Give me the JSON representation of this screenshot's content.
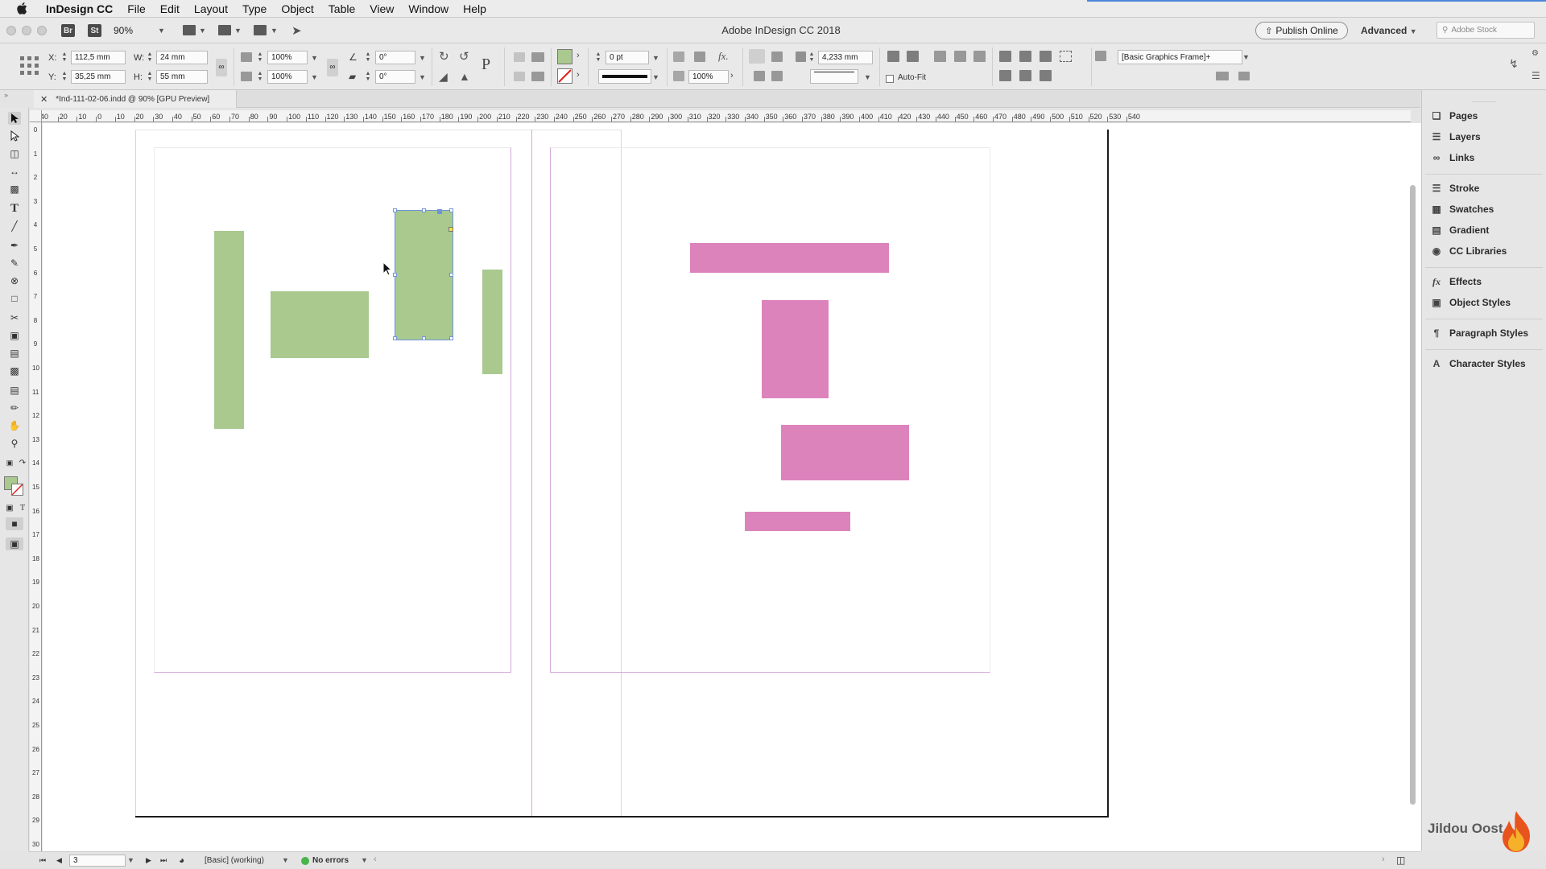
{
  "menubar": {
    "app_name": "InDesign CC",
    "items": [
      "File",
      "Edit",
      "Layout",
      "Type",
      "Object",
      "Table",
      "View",
      "Window",
      "Help"
    ]
  },
  "appbar": {
    "bridge_label": "Br",
    "stock_label": "St",
    "zoom": "90%",
    "title": "Adobe InDesign CC 2018",
    "publish_label": "Publish Online",
    "workspace_label": "Advanced",
    "search_placeholder": "Adobe Stock"
  },
  "control": {
    "x_label": "X:",
    "x_value": "112,5 mm",
    "y_label": "Y:",
    "y_value": "35,25 mm",
    "w_label": "W:",
    "w_value": "24 mm",
    "h_label": "H:",
    "h_value": "55 mm",
    "scale_x": "100%",
    "scale_y": "100%",
    "rotate": "0°",
    "shear": "0°",
    "stroke_weight": "0 pt",
    "opacity": "100%",
    "corner": "4,233 mm",
    "autofit_label": "Auto-Fit",
    "object_style": "[Basic Graphics Frame]+",
    "fill_color": "#a9c98f"
  },
  "document": {
    "tab_label": "*Ind-111-02-06.indd @ 90% [GPU Preview]"
  },
  "ruler": {
    "h_labels": [
      "40",
      "20",
      "10",
      "0",
      "10",
      "20",
      "30",
      "40",
      "50",
      "60",
      "70",
      "80",
      "90",
      "100",
      "110",
      "120",
      "130",
      "140",
      "150",
      "160",
      "170",
      "180",
      "190",
      "200",
      "210",
      "220",
      "230",
      "240",
      "250",
      "260",
      "270",
      "280",
      "290",
      "300",
      "310",
      "320",
      "330",
      "340",
      "350",
      "360",
      "370",
      "380",
      "390",
      "400",
      "410",
      "420",
      "430",
      "440",
      "450",
      "460",
      "470",
      "480",
      "490",
      "500",
      "510",
      "520",
      "530",
      "540"
    ],
    "v_labels": [
      "0",
      "1",
      "2",
      "3",
      "4",
      "5",
      "6",
      "7",
      "8",
      "9",
      "10",
      "11",
      "12",
      "13",
      "14",
      "15",
      "16",
      "17",
      "18",
      "19",
      "20",
      "21",
      "22",
      "23",
      "24",
      "25",
      "26",
      "27",
      "28",
      "29",
      "30"
    ]
  },
  "statusbar": {
    "page": "3",
    "profile": "[Basic] (working)",
    "preflight": "No errors"
  },
  "panels": {
    "group1": [
      "Pages",
      "Layers",
      "Links"
    ],
    "group2": [
      "Stroke",
      "Swatches",
      "Gradient",
      "CC Libraries"
    ],
    "group3": [
      "Effects",
      "Object Styles"
    ],
    "group4": [
      "Paragraph Styles"
    ],
    "group5": [
      "Character Styles"
    ]
  },
  "colors": {
    "green_frame": "#a9c98f",
    "pink_frame": "#dd83bc",
    "selection": "#6f95d6",
    "margin_guide": "#d3a8d6"
  },
  "watermark": "Jildou Oost"
}
